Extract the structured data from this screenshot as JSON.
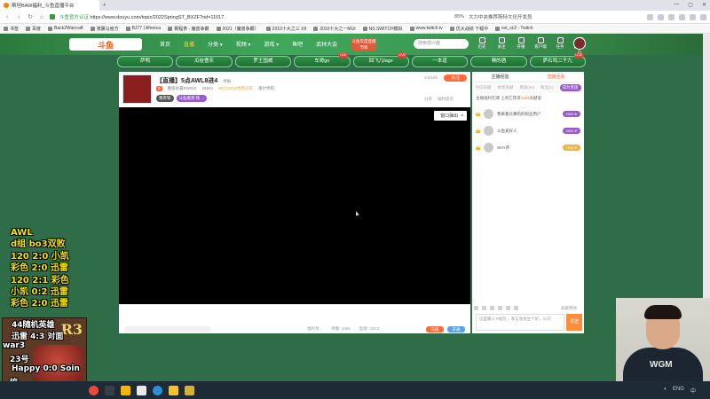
{
  "browser": {
    "tabs": [
      {
        "label": "斯坦BAW福利_斗鱼直播平台",
        "active": true
      },
      {
        "label": "新标签页",
        "active": false
      }
    ],
    "new_tab": "+",
    "url_secure": "斗鱼官方认证 ",
    "url_path": "https://www.douyu.com/topic/2022SpringST_BXZF?rid=11017",
    "zoom": "85%",
    "search_text": "大力中央推荐斯特文化开发员",
    "bookmarks": [
      "书签",
      "百度",
      "Back2Warcraft",
      "骑骡马官方",
      "BJ77 | Afreeca",
      "赛程表 - 魔兽争霸",
      "2021（魔兽争霸）",
      "2010十大之三 XII",
      "2010十大之一MUI",
      "NS SWITCH模拟",
      "www.twitch.tv",
      "优大战绩 下载中",
      "esl_sc2 - Twitch"
    ]
  },
  "site": {
    "logo": "斗鱼",
    "nav": [
      {
        "label": "首页",
        "active": false
      },
      {
        "label": "直播",
        "active": true
      },
      {
        "label": "分类 ▾",
        "active": false
      },
      {
        "label": "视频 ▾",
        "active": false
      },
      {
        "label": "游戏 ▾",
        "active": false
      },
      {
        "label": "鱼吧",
        "active": false
      },
      {
        "label": "武林大会",
        "active": false
      }
    ],
    "header_pill": "斗鱼年度直播节目",
    "search_placeholder": "搜索感兴趣",
    "header_icons": [
      "历史",
      "关注",
      "开播",
      "客户端",
      "任务",
      "我的中心"
    ],
    "categories": [
      {
        "label": "萨鸭",
        "live": false
      },
      {
        "label": "瓜娃曹灰",
        "live": false
      },
      {
        "label": "罗王国威",
        "live": false
      },
      {
        "label": "车哥go",
        "live": true
      },
      {
        "label": "回飞儿fage",
        "live": true
      },
      {
        "label": "一本道",
        "live": false
      },
      {
        "label": "噢的酒",
        "live": false
      },
      {
        "label": "萨石鸡二千九",
        "live": true
      }
    ]
  },
  "room": {
    "title": "【直播】5点AWL8进4",
    "title_tag": "举报",
    "meta": [
      "同游戏...",
      "魔兽争...",
      "/",
      "RTL"
    ],
    "level": "5",
    "anchor_name": "魔兽争霸RW000",
    "viewer_count": "25944",
    "wcb_tag": "WCG2019世界冠军",
    "more_tag": "蓬尔伊职",
    "badges": [
      "尊贵铁",
      "斗鱼嘉宾 铁 ..."
    ],
    "follow_count": "440190",
    "follow_button": "关注",
    "share_items": [
      "分享",
      "福利提示"
    ],
    "float_button": "窗口弹出",
    "float_close": "×",
    "gift_stats": [
      "福利领...",
      "余额: 1055",
      "鱼翅: 325.2"
    ],
    "pay_buttons": [
      "充值",
      "开通"
    ]
  },
  "sidebar": {
    "tabs": [
      {
        "label": "主播经验",
        "active": false
      },
      {
        "label": "直播回看",
        "active": true
      }
    ],
    "rank_tabs": [
      {
        "label": "今日贡献",
        "active": false
      },
      {
        "label": "本周贡献",
        "active": false
      },
      {
        "label": "贵族(64)",
        "active": false
      },
      {
        "label": "粉丝(1)",
        "active": false
      },
      {
        "label": "成为贵族",
        "active": true
      }
    ],
    "note": "主播福利在哪 上周它获得",
    "note_highlight": "1184",
    "note_suffix": "贡献值",
    "ranks": [
      {
        "name": "我来看比赛的的粉丝用户",
        "pill": "2000 ♥",
        "gold": false
      },
      {
        "name": "斗鱼爱好人",
        "pill": "2000 ♥",
        "gold": false
      },
      {
        "name": "WAY开",
        "pill": "1000 ♥",
        "gold": true
      }
    ],
    "chat_shield": "屏蔽特效",
    "chat_placeholder": "这里输入'#福包'，发言会找生个好，公司",
    "send_button": "发送"
  },
  "overlay": {
    "lines": [
      "AWL",
      "d组 bo3双败",
      "120 2:0 小凯",
      "彩色 2:0 迅雷",
      "120 2:1 彩色",
      "小凯 0:2 迅雷",
      "彩色 2:0 迅雷"
    ],
    "bottom_lines": [
      "44随机英雄",
      "迅雷 4:3 对面",
      "war3",
      "23号",
      "Happy 0:0 Soin",
      "培",
      "飞"
    ],
    "bottom_logo": "R3"
  },
  "webcam": {
    "shirt_logo": "WGM"
  },
  "taskbar": {
    "tray": [
      "ENG",
      "中"
    ]
  },
  "colors": {
    "accent": "#ff6b3d",
    "page_bg": "#2e6d48",
    "overlay_text": "#f4e600"
  }
}
